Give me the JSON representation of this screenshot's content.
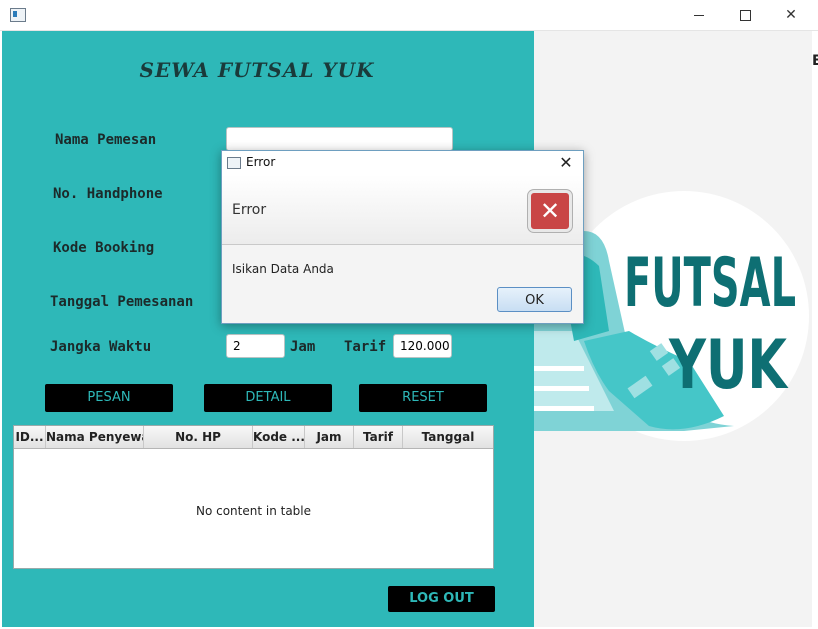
{
  "window": {
    "icon": "app-window-icon",
    "controls": {
      "minimize": "minimize-icon",
      "maximize": "maximize-icon",
      "close": "✕"
    }
  },
  "app": {
    "title": "SEWA FUTSAL YUK",
    "brand_color": "#2eb8b8",
    "logo_text": [
      "FUTSAL",
      "YUK"
    ]
  },
  "form": {
    "nama_pemesan": {
      "label": "Nama Pemesan",
      "value": ""
    },
    "no_handphone": {
      "label": "No. Handphone"
    },
    "kode_booking": {
      "label": "Kode Booking"
    },
    "tanggal_pemesanan": {
      "label": "Tanggal Pemesanan"
    },
    "jangka_waktu": {
      "label": "Jangka Waktu",
      "value": "2",
      "unit": "Jam"
    },
    "tarif": {
      "label": "Tarif",
      "value": "120.000"
    }
  },
  "buttons": {
    "pesan": "PESAN",
    "detail": "DETAIL",
    "reset": "RESET",
    "logout": "LOG OUT"
  },
  "table": {
    "columns": [
      "ID...",
      "Nama Penyewa",
      "No. HP",
      "Kode ...",
      "Jam",
      "Tarif",
      "Tanggal"
    ],
    "empty_message": "No content in table"
  },
  "dialog": {
    "title": "Error",
    "close": "✕",
    "heading": "Error",
    "icon": "error-x-icon",
    "icon_glyph": "✕",
    "message": "Isikan Data Anda",
    "ok_label": "OK"
  }
}
